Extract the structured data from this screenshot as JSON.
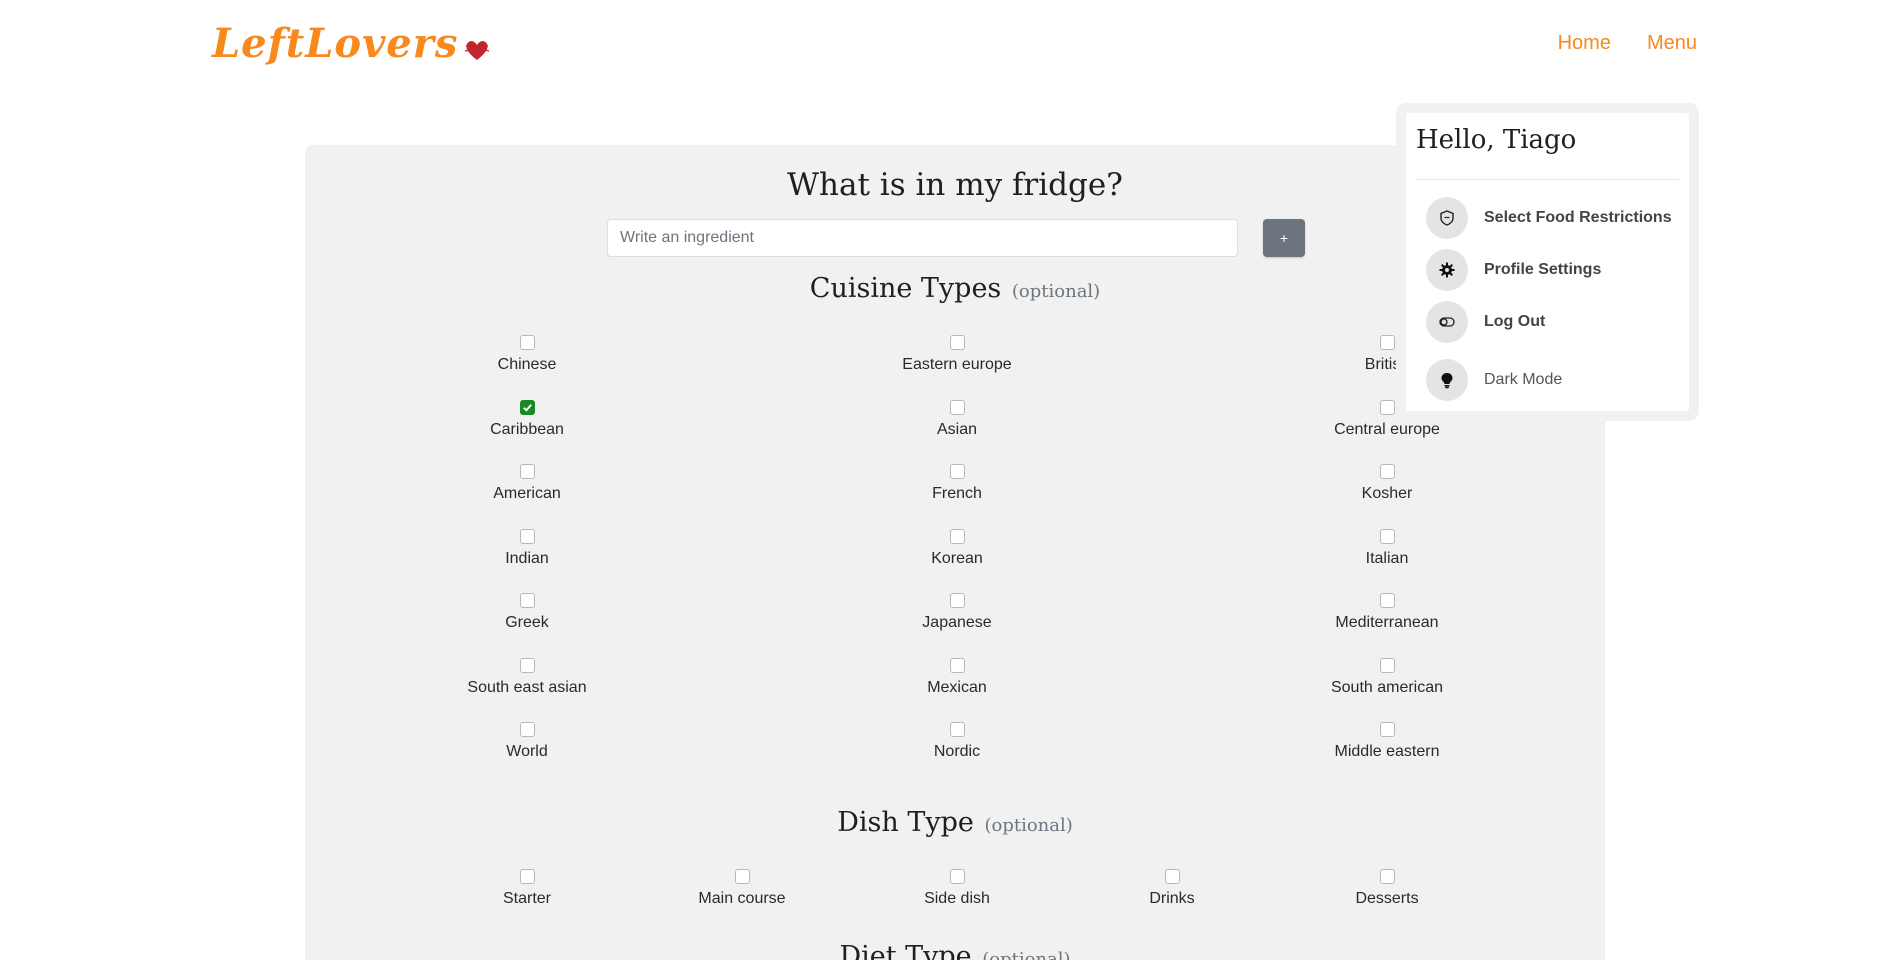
{
  "header": {
    "brand": "LeftLovers",
    "nav": {
      "home": "Home",
      "menu": "Menu"
    }
  },
  "main": {
    "title": "What is in my fridge?",
    "search": {
      "placeholder": "Write an ingredient",
      "value": "",
      "add_label": "+"
    },
    "cuisine": {
      "title": "Cuisine Types",
      "optional": "(optional)",
      "options": [
        {
          "label": "Chinese",
          "checked": false
        },
        {
          "label": "Eastern europe",
          "checked": false
        },
        {
          "label": "British",
          "checked": false
        },
        {
          "label": "Caribbean",
          "checked": true
        },
        {
          "label": "Asian",
          "checked": false
        },
        {
          "label": "Central europe",
          "checked": false
        },
        {
          "label": "American",
          "checked": false
        },
        {
          "label": "French",
          "checked": false
        },
        {
          "label": "Kosher",
          "checked": false
        },
        {
          "label": "Indian",
          "checked": false
        },
        {
          "label": "Korean",
          "checked": false
        },
        {
          "label": "Italian",
          "checked": false
        },
        {
          "label": "Greek",
          "checked": false
        },
        {
          "label": "Japanese",
          "checked": false
        },
        {
          "label": "Mediterranean",
          "checked": false
        },
        {
          "label": "South east asian",
          "checked": false
        },
        {
          "label": "Mexican",
          "checked": false
        },
        {
          "label": "South american",
          "checked": false
        },
        {
          "label": "World",
          "checked": false
        },
        {
          "label": "Nordic",
          "checked": false
        },
        {
          "label": "Middle eastern",
          "checked": false
        }
      ]
    },
    "dish": {
      "title": "Dish Type",
      "optional": "(optional)",
      "options": [
        {
          "label": "Starter",
          "checked": false
        },
        {
          "label": "Main course",
          "checked": false
        },
        {
          "label": "Side dish",
          "checked": false
        },
        {
          "label": "Drinks",
          "checked": false
        },
        {
          "label": "Desserts",
          "checked": false
        }
      ]
    },
    "diet": {
      "title": "Diet Type",
      "optional": "(optional)"
    }
  },
  "dropdown": {
    "greeting": "Hello, Tiago",
    "items": [
      {
        "label": "Select Food Restrictions",
        "icon": "shield-icon"
      },
      {
        "label": "Profile Settings",
        "icon": "gear-icon"
      },
      {
        "label": "Log Out",
        "icon": "toggle-icon"
      },
      {
        "label": "Dark Mode",
        "icon": "lightbulb-icon"
      }
    ]
  },
  "colors": {
    "accent": "#f7891f",
    "checked": "#188a24",
    "card": "#f1f1f1",
    "button": "#6c757d"
  }
}
